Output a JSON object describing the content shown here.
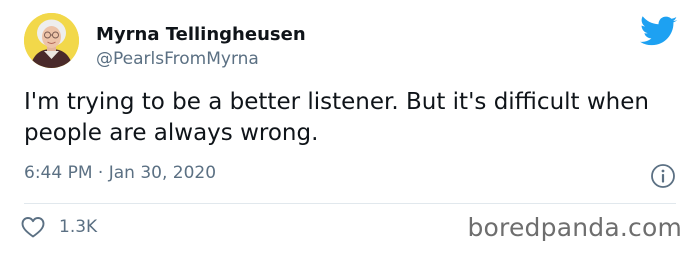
{
  "author": {
    "display_name": "Myrna Tellingheusen",
    "handle": "@PearlsFromMyrna"
  },
  "tweet": {
    "text": "I'm trying to be a better listener. But it's difficult when people are always wrong.",
    "timestamp": "6:44 PM · Jan 30, 2020"
  },
  "engagement": {
    "likes": "1.3K"
  },
  "watermark": "boredpanda.com",
  "colors": {
    "twitter_blue": "#1da1f2",
    "secondary_text": "#5b7083",
    "avatar_background": "#f2d84a"
  },
  "icons": {
    "brand": "twitter-bird-icon",
    "info": "info-icon",
    "like": "heart-icon"
  }
}
